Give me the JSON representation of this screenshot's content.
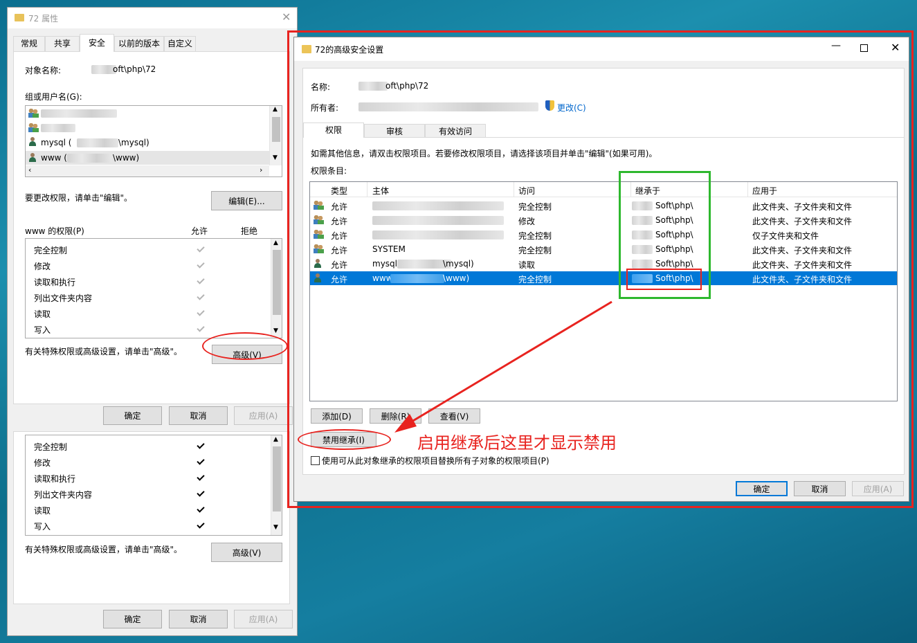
{
  "props": {
    "title": "72 属性",
    "tabs": [
      "常规",
      "共享",
      "安全",
      "以前的版本",
      "自定义"
    ],
    "object_label": "对象名称:",
    "object_value": "oft\\php\\72",
    "group_label": "组或用户名(G):",
    "users": [
      "mysql (",
      "\\mysql)",
      "www (",
      "\\www)"
    ],
    "change_hint": "要更改权限，请单击\"编辑\"。",
    "edit_button": "编辑(E)...",
    "perm_header": "www 的权限(P)",
    "allow_col": "允许",
    "deny_col": "拒绝",
    "permissions": [
      "完全控制",
      "修改",
      "读取和执行",
      "列出文件夹内容",
      "读取",
      "写入"
    ],
    "special_hint": "有关特殊权限或高级设置，请单击\"高级\"。",
    "advanced_button": "高级(V)",
    "ok": "确定",
    "cancel": "取消",
    "apply": "应用(A)"
  },
  "adv": {
    "title": "72的高级安全设置",
    "name_label": "名称:",
    "name_value": "oft\\php\\72",
    "owner_label": "所有者:",
    "change_link": "更改(C)",
    "tabs": [
      "权限",
      "审核",
      "有效访问"
    ],
    "info": "如需其他信息，请双击权限项目。若要修改权限项目，请选择该项目并单击\"编辑\"(如果可用)。",
    "entries_label": "权限条目:",
    "columns": [
      "类型",
      "主体",
      "访问",
      "继承于",
      "应用于"
    ],
    "rows": [
      {
        "type": "允许",
        "principal": "",
        "access": "完全控制",
        "inherit": "Soft\\php\\",
        "applies": "此文件夹、子文件夹和文件",
        "icon": "group"
      },
      {
        "type": "允许",
        "principal": "",
        "access": "修改",
        "inherit": "Soft\\php\\",
        "applies": "此文件夹、子文件夹和文件",
        "icon": "group"
      },
      {
        "type": "允许",
        "principal": "",
        "access": "完全控制",
        "inherit": "Soft\\php\\",
        "applies": "仅子文件夹和文件",
        "icon": "group"
      },
      {
        "type": "允许",
        "principal": "SYSTEM",
        "access": "完全控制",
        "inherit": "Soft\\php\\",
        "applies": "此文件夹、子文件夹和文件",
        "icon": "group"
      },
      {
        "type": "允许",
        "principal": "mysql",
        "principal_suffix": "\\mysql)",
        "access": "读取",
        "inherit": "Soft\\php\\",
        "applies": "此文件夹、子文件夹和文件",
        "icon": "user"
      },
      {
        "type": "允许",
        "principal": "www",
        "principal_suffix": "\\www)",
        "access": "完全控制",
        "inherit": "Soft\\php\\",
        "applies": "此文件夹、子文件夹和文件",
        "icon": "user",
        "selected": true
      }
    ],
    "add_button": "添加(D)",
    "remove_button": "删除(R)",
    "view_button": "查看(V)",
    "disable_inherit_button": "禁用继承(I)",
    "replace_checkbox": "使用可从此对象继承的权限项目替换所有子对象的权限项目(P)",
    "ok": "确定",
    "cancel": "取消",
    "apply": "应用(A)"
  },
  "annotation": "启用继承后这里才显示禁用",
  "colors": {
    "select": "#0078d7",
    "red": "#e8231f",
    "green": "#2eb82e"
  }
}
